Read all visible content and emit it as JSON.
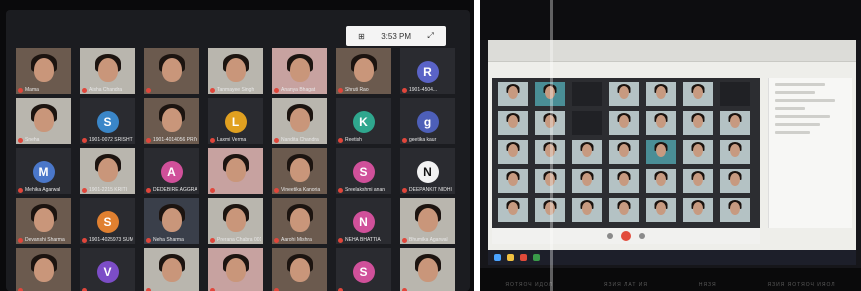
{
  "left_photo": {
    "clock": "3:53 PM",
    "participants": [
      {
        "name": "Mama",
        "kind": "video",
        "tone": "warm"
      },
      {
        "name": "Aisha Chandra",
        "kind": "video",
        "tone": "light"
      },
      {
        "name": "",
        "kind": "video",
        "tone": "warm"
      },
      {
        "name": "Tanmayee Singh",
        "kind": "video",
        "tone": "light"
      },
      {
        "name": "Ananya Bhagat",
        "kind": "video",
        "tone": "pink"
      },
      {
        "name": "Shruti Rao",
        "kind": "video",
        "tone": "warm"
      },
      {
        "name": "1901-4504...",
        "kind": "avatar",
        "letter": "R",
        "color": "#5a63c7"
      },
      {
        "name": "Sneha",
        "kind": "video",
        "tone": "light"
      },
      {
        "name": "1901-0072 SRISHTI S...",
        "kind": "avatar",
        "letter": "S",
        "color": "#3a86c8"
      },
      {
        "name": "1901-4014056 PRIYA",
        "kind": "video",
        "tone": "warm"
      },
      {
        "name": "Laxmi Verma",
        "kind": "avatar",
        "letter": "L",
        "color": "#e0a020"
      },
      {
        "name": "Nandita Chandra",
        "kind": "video",
        "tone": "light"
      },
      {
        "name": "Reetish",
        "kind": "avatar",
        "letter": "K",
        "color": "#2fa78e"
      },
      {
        "name": "geetika kaur",
        "kind": "avatar",
        "letter": "g",
        "color": "#4d5fb8"
      },
      {
        "name": "Mehika Agarwal",
        "kind": "avatar",
        "letter": "M",
        "color": "#4a77c9"
      },
      {
        "name": "1901-2215 KRITI",
        "kind": "video",
        "tone": "light"
      },
      {
        "name": "DEDEBIRE AGGRAWAL",
        "kind": "avatar",
        "letter": "A",
        "color": "#d0509a"
      },
      {
        "name": "",
        "kind": "video",
        "tone": "pink"
      },
      {
        "name": "Vineetika Kanoria",
        "kind": "video",
        "tone": "warm"
      },
      {
        "name": "Sreelakshmi anan",
        "kind": "avatar",
        "letter": "S",
        "color": "#d0509a"
      },
      {
        "name": "DEEPANKIT NIDHI BO...",
        "kind": "avatar",
        "letter": "N",
        "color": "#f2f2f2",
        "dark_letter": true
      },
      {
        "name": "Devanshi Sharma",
        "kind": "video",
        "tone": "warm"
      },
      {
        "name": "1901-4025973 SUMIT",
        "kind": "avatar",
        "letter": "S",
        "color": "#e08030"
      },
      {
        "name": "Neha Sharma",
        "kind": "video",
        "tone": "dark"
      },
      {
        "name": "Prerana Chabra 001",
        "kind": "video",
        "tone": "light"
      },
      {
        "name": "Aarohi Mishra",
        "kind": "video",
        "tone": "warm"
      },
      {
        "name": "NEHA BHATTIA",
        "kind": "avatar",
        "letter": "N",
        "color": "#d0509a"
      },
      {
        "name": "Bhumika Agarwal",
        "kind": "video",
        "tone": "light"
      },
      {
        "name": "",
        "kind": "video",
        "tone": "warm"
      },
      {
        "name": "",
        "kind": "avatar",
        "letter": "V",
        "color": "#7c4dc7"
      },
      {
        "name": "",
        "kind": "video",
        "tone": "light"
      },
      {
        "name": "",
        "kind": "video",
        "tone": "pink"
      },
      {
        "name": "",
        "kind": "video",
        "tone": "warm"
      },
      {
        "name": "",
        "kind": "avatar",
        "letter": "S",
        "color": "#d0509a"
      },
      {
        "name": "",
        "kind": "video",
        "tone": "light"
      }
    ]
  },
  "right_photo": {
    "keyboard_labels": [
      "ЯОТЯОЧ ИДОЛ",
      "ЯЗИЯ ЛАТ ИЯ",
      "НЯЗЯ",
      "ЯЗИЯ ЯОТЯОЧ ИЯОЛ"
    ],
    "grid": [
      [
        "light",
        "teal",
        "dark",
        "light",
        "light",
        "light",
        "dark"
      ],
      [
        "light",
        "light",
        "dark",
        "light",
        "light",
        "light",
        "light"
      ],
      [
        "light",
        "light",
        "light",
        "light",
        "teal",
        "light",
        "light"
      ],
      [
        "light",
        "light",
        "light",
        "light",
        "light",
        "light",
        "light"
      ],
      [
        "light",
        "light",
        "light",
        "light",
        "light",
        "light",
        "light"
      ]
    ]
  }
}
